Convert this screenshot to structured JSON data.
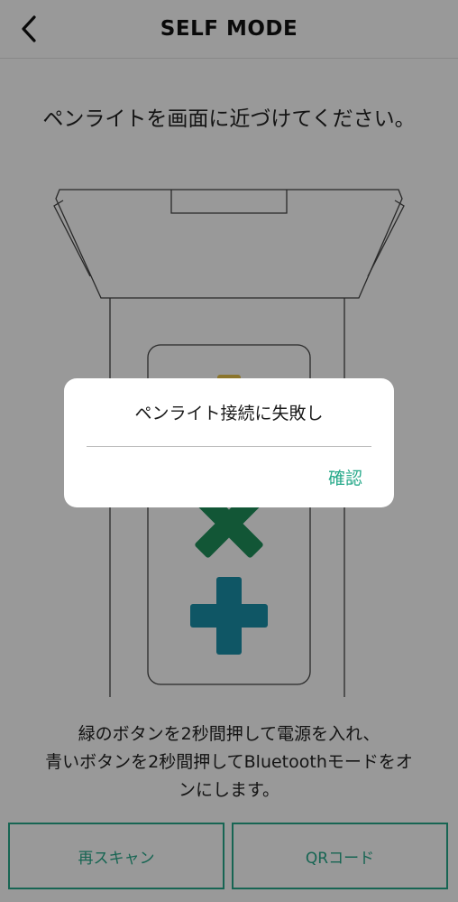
{
  "header": {
    "title": "SELF MODE",
    "back_icon": "chevron-left-icon"
  },
  "main": {
    "instruction": "ペンライトを画面に近づけてください。",
    "bottom_text_lines": [
      "緑のボタンを2秒間押して電源を入れ、",
      "青いボタンを2秒間押してBluetoothモードをオ",
      "ンにします。"
    ]
  },
  "buttons": {
    "rescan_label": "再スキャン",
    "qr_label": "QRコード"
  },
  "dialog": {
    "message": "ペンライト接続に失敗し",
    "confirm_label": "確認"
  },
  "colors": {
    "accent": "#27a98a",
    "cross_green": "#1f8f5a",
    "plus_blue": "#1a8fa8",
    "yellow_button": "#e8c34a"
  }
}
